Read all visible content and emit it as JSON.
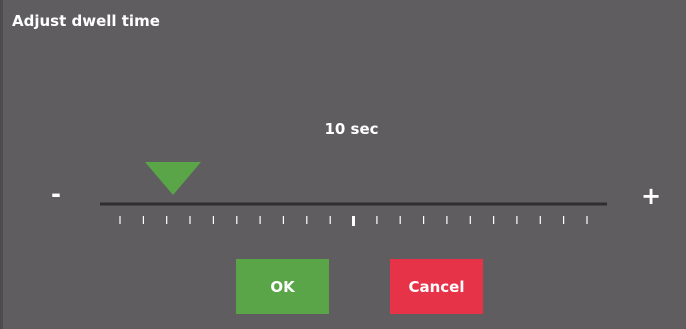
{
  "dialog": {
    "title": "Adjust dwell time"
  },
  "slider": {
    "value_text": "10 sec",
    "minus_label": "-",
    "plus_label": "+",
    "tick_count": 21,
    "selected_tick_index": 10,
    "thumb_fraction": 0.143,
    "thumb_color": "#5aa548",
    "track_color": "#2f2e30",
    "tick_color": "#ffffff"
  },
  "buttons": {
    "ok_label": "OK",
    "ok_color": "#5aa548",
    "cancel_label": "Cancel",
    "cancel_color": "#e73348"
  }
}
